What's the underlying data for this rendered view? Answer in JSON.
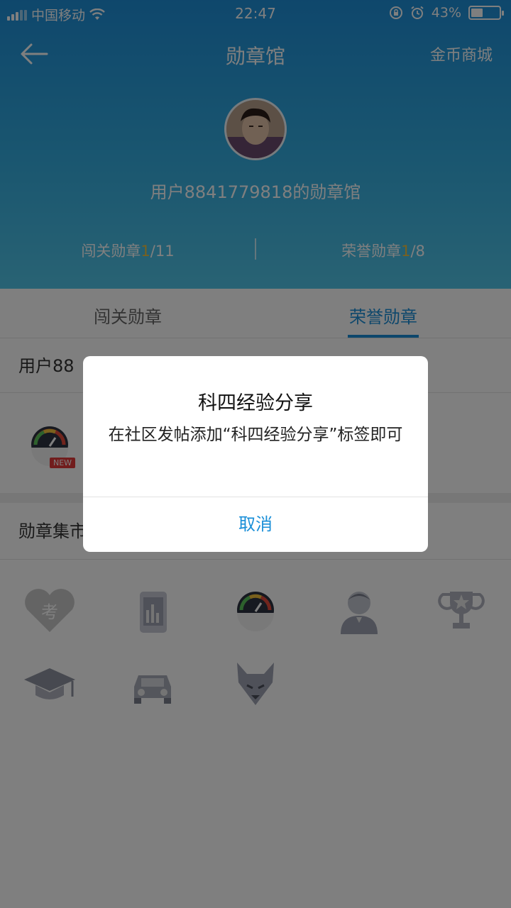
{
  "status": {
    "carrier": "中国移动",
    "time": "22:47",
    "battery": "43%",
    "battery_level": 0.43
  },
  "nav": {
    "title": "勋章馆",
    "right_link": "金币商城"
  },
  "profile": {
    "username_title": "用户8841779818的勋章馆"
  },
  "counts": {
    "chuangguan": {
      "label": "闯关勋章",
      "earned": "1",
      "total": "/11"
    },
    "rongyu": {
      "label": "荣誉勋章",
      "earned": "1",
      "total": "/8"
    }
  },
  "tabs": [
    {
      "label": "闯关勋章"
    },
    {
      "label": "荣誉勋章"
    }
  ],
  "sections": {
    "user_badges_title": "用户88",
    "badge_market_title": "勋章集市"
  },
  "new_tag": "NEW",
  "grid_icons": [
    "heart-kao-icon",
    "phone-chart-icon",
    "speedometer-icon",
    "person-avatar-icon",
    "trophy-icon",
    "graduation-cap-icon",
    "car-icon",
    "wolf-icon"
  ],
  "grid_icon_text": {
    "heart": "考"
  },
  "dialog": {
    "title": "科四经验分享",
    "message": "在社区发帖添加“科四经验分享”标签即可",
    "cancel": "取消"
  },
  "colors": {
    "accent": "#1a8fd8",
    "highlight": "#f5c23a",
    "header_gradient_top": "#1e8fd9",
    "header_gradient_bottom": "#52c6e8"
  }
}
